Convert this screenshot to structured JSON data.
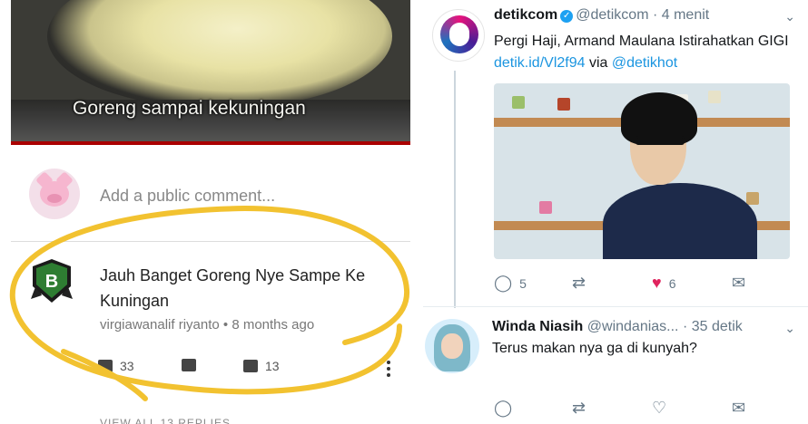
{
  "youtube": {
    "video_caption": "Goreng sampai kekuningan",
    "comment_placeholder": "Add a public comment...",
    "comment": {
      "text": "Jauh Banget Goreng Nye Sampe Ke Kuningan",
      "author": "virgiawanalif riyanto",
      "time": "8 months ago",
      "meta": "virgiawanalif riyanto • 8 months ago",
      "likes": "33",
      "replies_count": "13",
      "replies_link": "VIEW ALL 13 REPLIES"
    },
    "highlight_color": "#f2c230"
  },
  "twitter": {
    "tweet": {
      "name": "detikcom",
      "handle": "@detikcom",
      "time": "· 4 menit",
      "text_main": "Pergi Haji, Armand Maulana Istirahatkan GIGI",
      "link": "detik.id/Vl2f94",
      "via": "via",
      "via_handle": "@detikhot",
      "reply_count": "5",
      "retweet_count": "",
      "like_count": "6"
    },
    "reply": {
      "name": "Winda Niasih",
      "handle": "@windanias...",
      "time": "· 35 detik",
      "text": "Terus makan nya ga di kunyah?"
    },
    "accent": "#1b95e0",
    "like_color": "#e0245e"
  },
  "icons": {
    "reply": "comment-bubble-icon",
    "retweet": "retweet-icon",
    "like": "heart-icon",
    "dm": "envelope-icon",
    "verified": "verified-badge-icon",
    "more": "more-vertical-icon"
  }
}
